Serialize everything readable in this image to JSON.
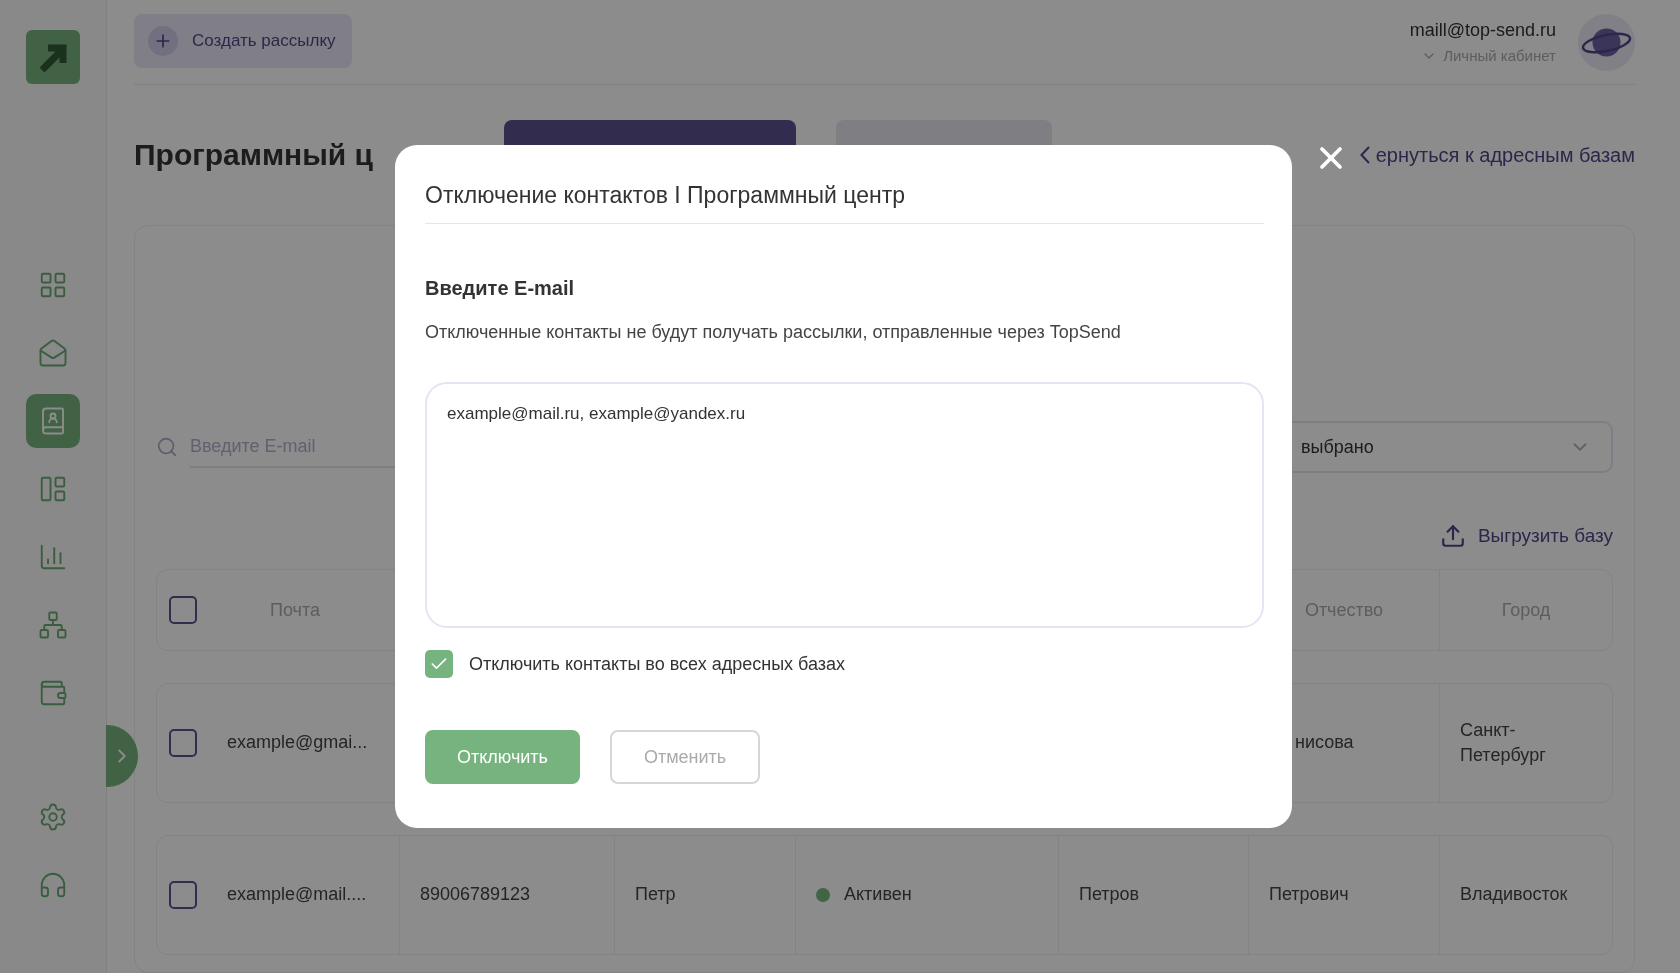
{
  "sidebar": {
    "items": [
      {
        "kind": "grid",
        "selected": false
      },
      {
        "kind": "mail",
        "selected": false
      },
      {
        "kind": "contacts",
        "selected": true
      },
      {
        "kind": "layout",
        "selected": false
      },
      {
        "kind": "chart",
        "selected": false
      },
      {
        "kind": "network",
        "selected": false
      },
      {
        "kind": "wallet",
        "selected": false
      }
    ],
    "bottom_items": [
      {
        "kind": "settings",
        "selected": false
      },
      {
        "kind": "support",
        "selected": false
      }
    ]
  },
  "header": {
    "create_button": "Создать рассылку",
    "account_email": "maill@top-send.ru",
    "account_menu": "Личный кабинет"
  },
  "page": {
    "title": "Программный ц",
    "back_link": "ернуться к адресным базам",
    "tabs": [
      {
        "selected": true
      },
      {
        "selected": false
      }
    ]
  },
  "filters": {
    "search_placeholder": "Введите E-mail",
    "select_value": "выбрано"
  },
  "export_button": "Выгрузить базу",
  "table": {
    "header_checked": false,
    "columns": [
      "Почта",
      null,
      null,
      null,
      null,
      "Отчество",
      "Город"
    ],
    "rows": [
      {
        "checked": false,
        "cells": [
          "example@gmai...",
          null,
          null,
          null,
          null,
          "нисова",
          "Санкт-Петербург"
        ]
      },
      {
        "checked": false,
        "cells": [
          "example@mail....",
          "89006789123",
          "Петр",
          {
            "kind": "status",
            "text": "Активен",
            "color": "#416444"
          },
          "Петров",
          "Петрович",
          "Владивосток"
        ]
      }
    ]
  },
  "modal": {
    "title": "Отключение контактов I Программный центр",
    "label": "Введите E-mail",
    "description": "Отключенные контакты не будут получать рассылки, отправленные через TopSend",
    "value": "example@mail.ru, example@yandex.ru",
    "checkbox": {
      "label": "Отключить контакты во всех адресных базах",
      "checked": true
    },
    "buttons": [
      {
        "label": "Отключить",
        "kind": "primary"
      },
      {
        "label": "Отменить",
        "kind": "secondary"
      }
    ]
  }
}
